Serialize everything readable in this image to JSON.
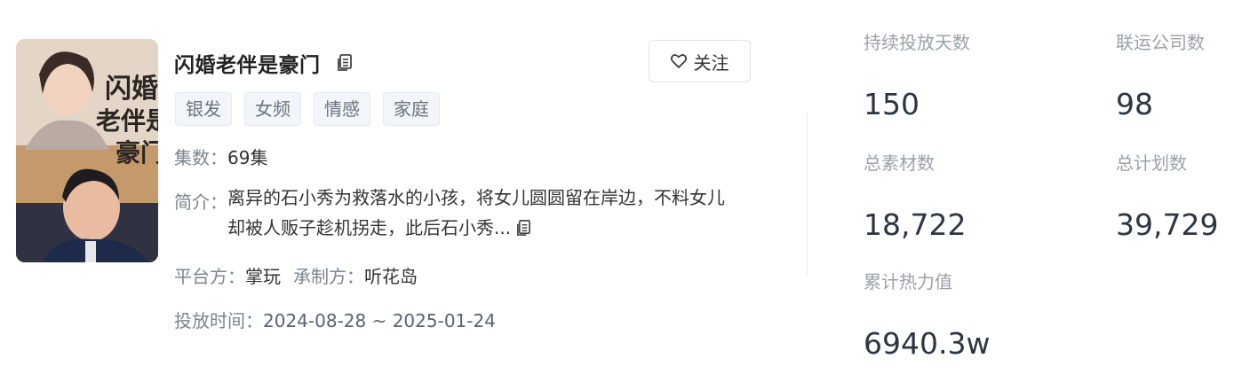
{
  "drama": {
    "title": "闪婚老伴是豪门",
    "poster_text": "闪婚老伴是豪门",
    "follow_label": "关注",
    "tags": [
      "银发",
      "女频",
      "情感",
      "家庭"
    ],
    "episodes_key": "集数：",
    "episodes_value": "69集",
    "intro_key": "简介：",
    "intro_value": "离异的石小秀为救落水的小孩，将女儿圆圆留在岸边，不料女儿却被人贩子趁机拐走，此后石小秀...",
    "platform_key": "平台方：",
    "platform_value": "掌玩",
    "producer_key": "承制方：",
    "producer_value": "听花岛",
    "period_key": "投放时间：",
    "period_value": "2024-08-28 ~ 2025-01-24"
  },
  "stats": [
    {
      "label": "持续投放天数",
      "value": "150"
    },
    {
      "label": "联运公司数",
      "value": "98"
    },
    {
      "label": "总素材数",
      "value": "18,722"
    },
    {
      "label": "总计划数",
      "value": "39,729"
    },
    {
      "label": "累计热力值",
      "value": "6940.3w"
    }
  ],
  "icons": {
    "copy": "copy-icon",
    "heart": "heart-icon"
  },
  "colors": {
    "stat_value": "#2c3542",
    "muted": "#9aa1ab",
    "tag_bg": "#f2f5fa"
  }
}
